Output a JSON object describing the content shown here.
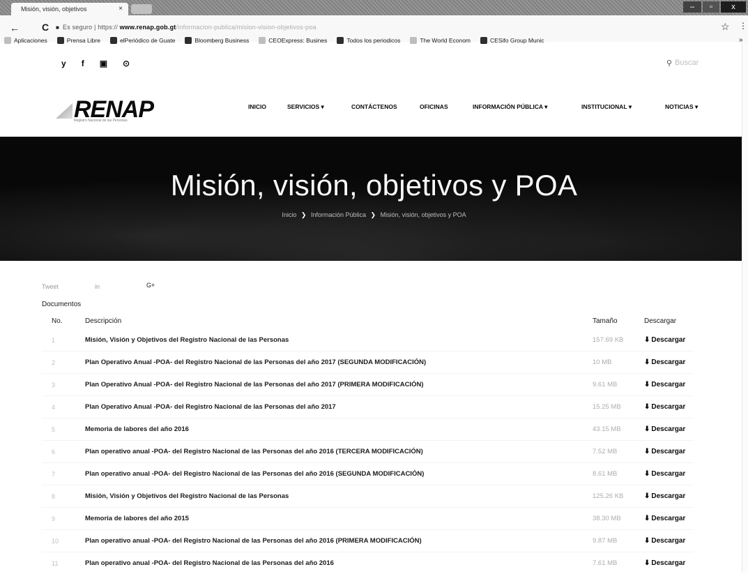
{
  "browser": {
    "tab_title": "Misión, visión, objetivos",
    "tab_close": "×",
    "win_min": "–",
    "win_max": "▫",
    "win_close": "x",
    "back": "←",
    "reload": "C",
    "lock": "■",
    "url_secure": "Es seguro",
    "url_scheme": "https://",
    "url_domain": "www.renap.gob.gt",
    "url_path": "/informacion-publica/mision-vision-objetivos-poa",
    "star": "☆",
    "menu": "⋮",
    "bookmarks": [
      {
        "label": "Aplicaciones"
      },
      {
        "label": "Prensa Libre"
      },
      {
        "label": "elPeriódico de Guate"
      },
      {
        "label": "Bloomberg Business"
      },
      {
        "label": "CEOExpress: Busines"
      },
      {
        "label": "Todos los periodicos"
      },
      {
        "label": "The World Econom"
      },
      {
        "label": "CESifo Group Munic"
      }
    ],
    "bookmarks_more": "»"
  },
  "header": {
    "social": [
      "y",
      "f",
      "▣",
      "⊙"
    ],
    "search_placeholder": "Buscar",
    "logo_text": "RENAP",
    "logo_sub": "Registro Nacional de las Personas",
    "nav": [
      {
        "label": "INICIO"
      },
      {
        "label": "SERVICIOS ▾"
      },
      {
        "label": "CONTÁCTENOS"
      },
      {
        "label": "OFICINAS"
      },
      {
        "label": "INFORMACIÓN PÚBLICA ▾"
      },
      {
        "label": "INSTITUCIONAL ▾"
      },
      {
        "label": "NOTICIAS ▾"
      }
    ]
  },
  "hero": {
    "title": "Misión, visión, objetivos y POA",
    "breadcrumb": [
      "Inicio",
      "Información Pública",
      "Misión, visión, objetivos y POA"
    ],
    "breadcrumb_sep": "❯"
  },
  "share": [
    "Tweet",
    "in",
    "G+"
  ],
  "documents": {
    "label": "Documentos",
    "headers": {
      "no": "No.",
      "desc": "Descripción",
      "size": "Tamaño",
      "download": "Descargar"
    },
    "download_icon": "⬇",
    "rows": [
      {
        "no": "1",
        "desc": "Misión, Visión y Objetivos del Registro Nacional de las Personas",
        "size": "157.69 KB",
        "dl": "Descargar"
      },
      {
        "no": "2",
        "desc": "Plan Operativo Anual -POA- del Registro Nacional de las Personas del año 2017 (SEGUNDA MODIFICACIÓN)",
        "size": "10 MB",
        "dl": "Descargar"
      },
      {
        "no": "3",
        "desc": "Plan Operativo Anual -POA- del Registro Nacional de las Personas del año 2017 (PRIMERA MODIFICACIÓN)",
        "size": "9.61 MB",
        "dl": "Descargar"
      },
      {
        "no": "4",
        "desc": "Plan Operativo Anual -POA- del Registro Nacional de las Personas del año 2017",
        "size": "15.25 MB",
        "dl": "Descargar"
      },
      {
        "no": "5",
        "desc": "Memoria de labores del año 2016",
        "size": "43.15 MB",
        "dl": "Descargar"
      },
      {
        "no": "6",
        "desc": "Plan operativo anual -POA- del Registro Nacional de las Personas del año 2016 (TERCERA MODIFICACIÓN)",
        "size": "7.52 MB",
        "dl": "Descargar"
      },
      {
        "no": "7",
        "desc": "Plan operativo anual -POA- del Registro Nacional de las Personas del año 2016 (SEGUNDA MODIFICACIÓN)",
        "size": "8.61 MB",
        "dl": "Descargar"
      },
      {
        "no": "8",
        "desc": "Misión, Visión y Objetivos del Registro Nacional de las Personas",
        "size": "125.26 KB",
        "dl": "Descargar"
      },
      {
        "no": "9",
        "desc": "Memoria de labores del año 2015",
        "size": "38.30 MB",
        "dl": "Descargar"
      },
      {
        "no": "10",
        "desc": "Plan operativo anual -POA- del Registro Nacional de las Personas del año 2016 (PRIMERA MODIFICACIÓN)",
        "size": "9.87 MB",
        "dl": "Descargar"
      },
      {
        "no": "11",
        "desc": "Plan operativo anual -POA- del Registro Nacional de las Personas del año 2016",
        "size": "7.61 MB",
        "dl": "Descargar"
      }
    ]
  }
}
